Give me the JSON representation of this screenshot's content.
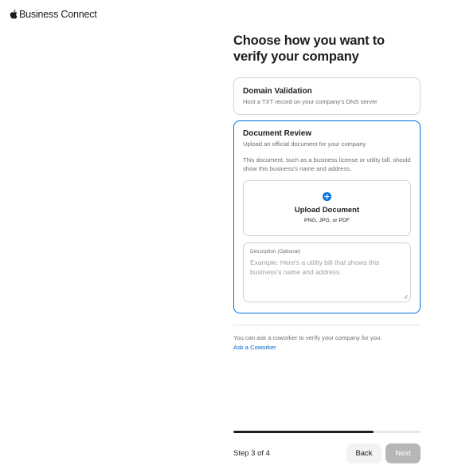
{
  "header": {
    "brand_icon": "apple-logo-icon",
    "brand_name": "Business Connect"
  },
  "main": {
    "title": "Choose how you want to verify your company",
    "options": [
      {
        "title": "Domain Validation",
        "subtitle": "Host a TXT record on your company's DNS server",
        "selected": false
      },
      {
        "title": "Document Review",
        "subtitle": "Upload an official document for your company",
        "note": "This document, such as a business license or utility bill, should show this business's name and address.",
        "selected": true
      }
    ],
    "upload": {
      "icon": "plus-circle-icon",
      "title": "Upload Document",
      "formats": "PNG, JPG, or PDF"
    },
    "description": {
      "label": "Description (Optional)",
      "placeholder": "Example: Here's a utility bill that shows this business's name and address.",
      "value": ""
    },
    "coworker": {
      "text": "You can ask a coworker to verify your company for you.",
      "link": "Ask a Coworker"
    }
  },
  "footer": {
    "step_label": "Step 3 of 4",
    "progress_fraction": 0.75,
    "back_label": "Back",
    "next_label": "Next",
    "next_enabled": false
  },
  "colors": {
    "accent": "#0071e3",
    "link": "#0066cc",
    "text": "#1d1d1f",
    "secondary_text": "#6e6e73",
    "border": "#d2d2d7",
    "disabled_button": "#b6b6b9"
  }
}
